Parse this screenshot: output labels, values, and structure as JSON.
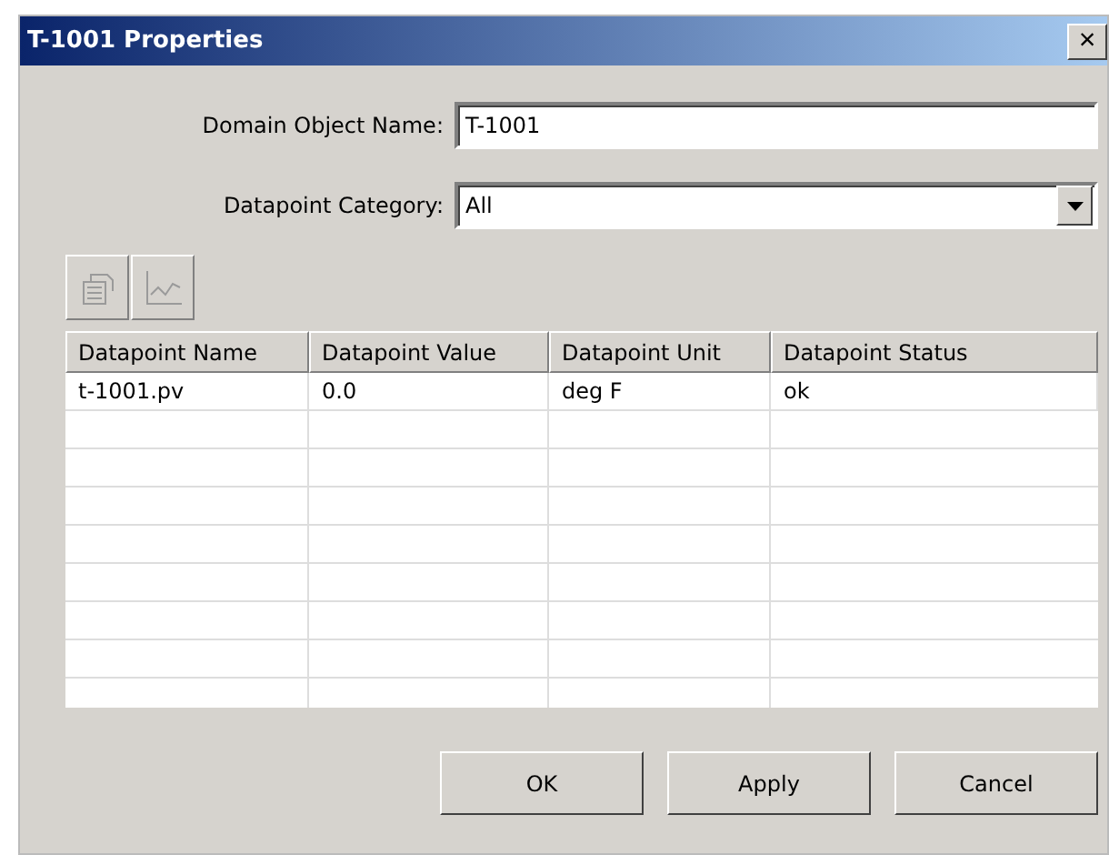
{
  "window": {
    "title": "T-1001 Properties",
    "close": "×"
  },
  "fields": [
    {
      "kind": "text",
      "label": "Domain Object Name:",
      "value": "T-1001"
    },
    {
      "kind": "dropdown",
      "label": "Datapoint Category:",
      "value": "All"
    }
  ],
  "toolbar": [
    {
      "kind": "properties",
      "disabled": true
    },
    {
      "kind": "trend",
      "disabled": true
    }
  ],
  "table": {
    "columns": [
      "Datapoint Name",
      "Datapoint Value",
      "Datapoint Unit",
      "Datapoint Status"
    ],
    "rows": [
      [
        "t-1001.pv",
        "0.0",
        "deg F",
        "ok"
      ]
    ]
  },
  "buttons": [
    "OK",
    "Apply",
    "Cancel"
  ]
}
